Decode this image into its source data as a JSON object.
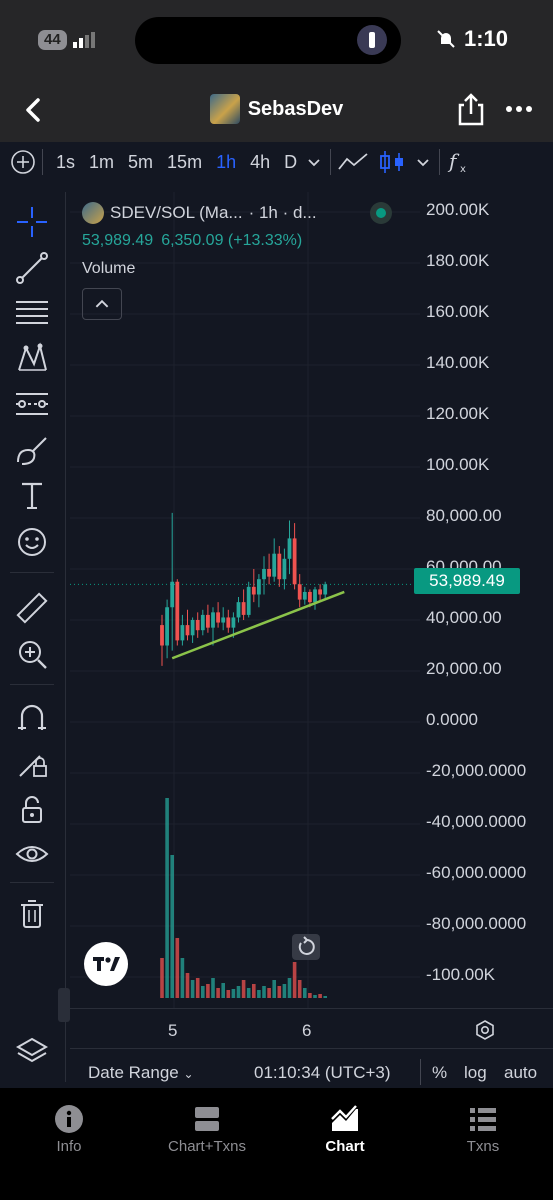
{
  "status": {
    "battery": "44",
    "time": "1:10"
  },
  "header": {
    "title": "SebasDev"
  },
  "toolbar": {
    "timeframes": [
      "1s",
      "1m",
      "5m",
      "15m",
      "1h",
      "4h",
      "D"
    ],
    "active": "1h"
  },
  "legend": {
    "symbol": "SDEV/SOL (Ma...",
    "interval": "· 1h · d...",
    "price": "53,989.49",
    "change": "6,350.09 (+13.33%)",
    "volume_label": "Volume"
  },
  "y_axis": [
    "200.00K",
    "180.00K",
    "160.00K",
    "140.00K",
    "120.00K",
    "100.00K",
    "80,000.00",
    "60,000.00",
    "40,000.00",
    "20,000.00",
    "0.0000",
    "-20,000.0000",
    "-40,000.0000",
    "-60,000.0000",
    "-80,000.0000",
    "-100.00K"
  ],
  "last_price_tag": "53,989.49",
  "x_axis": [
    "5",
    "6"
  ],
  "bottom": {
    "date_range": "Date Range",
    "time": "01:10:34 (UTC+3)",
    "percent": "%",
    "log": "log",
    "auto": "auto"
  },
  "tabs": [
    {
      "label": "Info",
      "icon": "info-icon"
    },
    {
      "label": "Chart+Txns",
      "icon": "split-layout-icon"
    },
    {
      "label": "Chart",
      "icon": "chart-icon",
      "active": true
    },
    {
      "label": "Txns",
      "icon": "list-icon"
    }
  ],
  "colors": {
    "up": "#26a69a",
    "down": "#ef5350",
    "accent": "#2962ff",
    "trendline": "#8bc34a",
    "price_line": "#089981"
  },
  "chart_data": {
    "type": "candlestick",
    "trendline": {
      "from": 25000,
      "to": 51000
    },
    "last_price": 53989.49,
    "ylim": [
      -100000,
      200000
    ],
    "candles": [
      {
        "o": 38000,
        "h": 42000,
        "l": 22000,
        "c": 30000
      },
      {
        "o": 30000,
        "h": 48000,
        "l": 25000,
        "c": 45000
      },
      {
        "o": 45000,
        "h": 82000,
        "l": 28000,
        "c": 55000
      },
      {
        "o": 55000,
        "h": 56000,
        "l": 30000,
        "c": 32000
      },
      {
        "o": 32000,
        "h": 42000,
        "l": 30000,
        "c": 38000
      },
      {
        "o": 38000,
        "h": 44000,
        "l": 32000,
        "c": 34000
      },
      {
        "o": 34000,
        "h": 41000,
        "l": 31000,
        "c": 40000
      },
      {
        "o": 40000,
        "h": 43000,
        "l": 33000,
        "c": 36000
      },
      {
        "o": 36000,
        "h": 44000,
        "l": 34000,
        "c": 42000
      },
      {
        "o": 42000,
        "h": 46000,
        "l": 35000,
        "c": 37000
      },
      {
        "o": 37000,
        "h": 45000,
        "l": 30000,
        "c": 43000
      },
      {
        "o": 43000,
        "h": 47000,
        "l": 37000,
        "c": 39000
      },
      {
        "o": 39000,
        "h": 45000,
        "l": 36000,
        "c": 41000
      },
      {
        "o": 41000,
        "h": 44000,
        "l": 35000,
        "c": 37000
      },
      {
        "o": 37000,
        "h": 43000,
        "l": 33000,
        "c": 41000
      },
      {
        "o": 41000,
        "h": 49000,
        "l": 39000,
        "c": 47000
      },
      {
        "o": 47000,
        "h": 52000,
        "l": 40000,
        "c": 42000
      },
      {
        "o": 42000,
        "h": 55000,
        "l": 41000,
        "c": 53000
      },
      {
        "o": 53000,
        "h": 60000,
        "l": 47000,
        "c": 50000
      },
      {
        "o": 50000,
        "h": 58000,
        "l": 45000,
        "c": 56000
      },
      {
        "o": 56000,
        "h": 65000,
        "l": 50000,
        "c": 60000
      },
      {
        "o": 60000,
        "h": 66000,
        "l": 54000,
        "c": 57000
      },
      {
        "o": 57000,
        "h": 72000,
        "l": 55000,
        "c": 66000
      },
      {
        "o": 66000,
        "h": 69000,
        "l": 53000,
        "c": 56000
      },
      {
        "o": 56000,
        "h": 68000,
        "l": 52000,
        "c": 64000
      },
      {
        "o": 64000,
        "h": 79000,
        "l": 58000,
        "c": 72000
      },
      {
        "o": 72000,
        "h": 78000,
        "l": 52000,
        "c": 54000
      },
      {
        "o": 54000,
        "h": 58000,
        "l": 45000,
        "c": 48000
      },
      {
        "o": 48000,
        "h": 53000,
        "l": 46000,
        "c": 51000
      },
      {
        "o": 51000,
        "h": 52000,
        "l": 45000,
        "c": 47000
      },
      {
        "o": 47000,
        "h": 53000,
        "l": 44000,
        "c": 52000
      },
      {
        "o": 52000,
        "h": 54000,
        "l": 47000,
        "c": 50000
      },
      {
        "o": 50000,
        "h": 55000,
        "l": 48000,
        "c": 54000
      }
    ],
    "volume": [
      40,
      200,
      143,
      60,
      40,
      25,
      18,
      20,
      12,
      14,
      20,
      10,
      15,
      8,
      9,
      12,
      18,
      10,
      14,
      8,
      12,
      10,
      18,
      12,
      14,
      20,
      36,
      18,
      10,
      5,
      3,
      4,
      2
    ]
  }
}
